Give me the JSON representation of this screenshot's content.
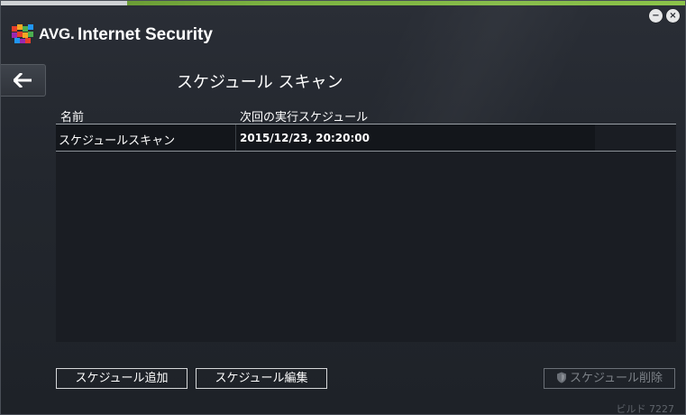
{
  "app": {
    "brand": "AVG.",
    "title": "Internet Security"
  },
  "window_controls": {
    "minimize_glyph": "−",
    "close_glyph": "×"
  },
  "nav": {
    "back_icon": "arrow-left-icon"
  },
  "page": {
    "title": "スケジュール スキャン"
  },
  "table": {
    "columns": [
      "名前",
      "次回の実行スケジュール"
    ],
    "rows": [
      {
        "name": "スケジュールスキャン",
        "next_run": "2015/12/23, 20:20:00"
      }
    ]
  },
  "buttons": {
    "add": "スケジュール追加",
    "edit": "スケジュール編集",
    "delete": "スケジュール削除"
  },
  "footer": {
    "build": "ビルド 7227"
  },
  "colors": {
    "background": "#23272e",
    "accent_green": "#7cb342",
    "text": "#ffffff",
    "disabled_text": "#7d8288"
  }
}
